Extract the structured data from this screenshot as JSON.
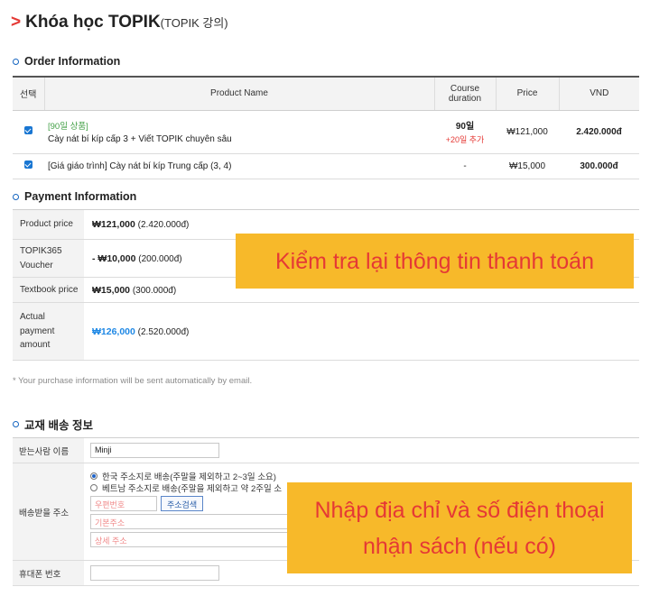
{
  "page_title": {
    "arrow": ">",
    "main": "Khóa học TOPIK",
    "sub": "(TOPIK 강의)"
  },
  "order": {
    "section_title": "Order Information",
    "headers": {
      "select": "선택",
      "product": "Product Name",
      "duration_line1": "Course",
      "duration_line2": "duration",
      "price": "Price",
      "vnd": "VND"
    },
    "rows": [
      {
        "tag": "[90일 상품]",
        "name": "Cày nát bí kíp cấp 3 + Viết TOPIK chuyên sâu",
        "duration": "90일",
        "duration_note": "+20일 추가",
        "price": "₩121,000",
        "vnd": "2.420.000đ"
      },
      {
        "name": "[Giá giáo trình] Cày nát bí kíp Trung cấp (3, 4)",
        "duration": "-",
        "price": "₩15,000",
        "vnd": "300.000đ"
      }
    ]
  },
  "payment": {
    "section_title": "Payment Information",
    "rows": [
      {
        "label": "Product price",
        "amount": "₩121,000",
        "vnd": "(2.420.000đ)"
      },
      {
        "label_line1": "TOPIK365",
        "label_line2": "Voucher",
        "amount": "- ₩10,000",
        "vnd": "(200.000đ)"
      },
      {
        "label": "Textbook price",
        "amount": "₩15,000",
        "vnd": "(300.000đ)"
      },
      {
        "label_line1": "Actual",
        "label_line2": "payment",
        "label_line3": "amount",
        "amount": "₩126,000",
        "vnd": "(2.520.000đ)"
      }
    ],
    "note": "* Your purchase information will be sent automatically by email."
  },
  "shipping": {
    "section_title": "교재 배송 정보",
    "recipient_label": "받는사람 이름",
    "recipient_value": "Minji",
    "address_label": "배송받을 주소",
    "option_korea": "한국 주소지로 배송(주말을 제외하고 2~3일 소요)",
    "option_vietnam": "베트남 주소지로 배송(주말을 제외하고 약 2주일 소",
    "postcode_placeholder": "우편번호",
    "search_button": "주소검색",
    "base_address_placeholder": "기본주소",
    "detail_address_placeholder": "상세 주소",
    "phone_label": "휴대폰 번호",
    "phone_value": ""
  },
  "callouts": {
    "check_info": "Kiểm tra lại thông tin thanh toán",
    "enter_address_line1": "Nhập địa chỉ và số điện thoại",
    "enter_address_line2": "nhận sách (nếu có)"
  },
  "colors": {
    "accent_red": "#e53935",
    "link_blue": "#1e88e5",
    "callout_bg": "#f7b92a",
    "section_ring": "#1565c0"
  }
}
